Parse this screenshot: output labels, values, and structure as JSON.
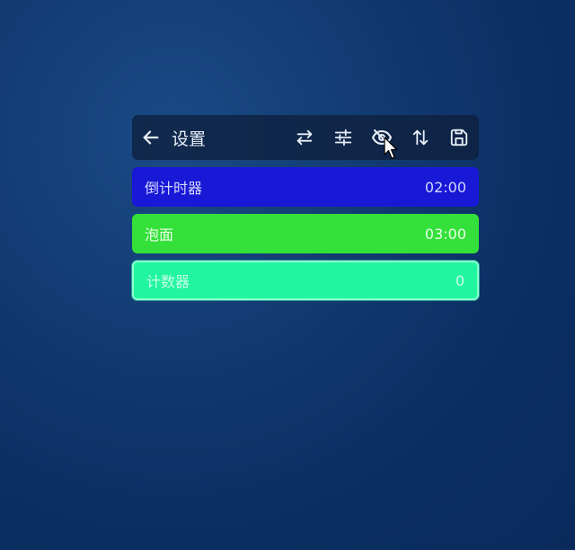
{
  "header": {
    "title": "设置"
  },
  "toolbar": {
    "icons": [
      "swap-icon",
      "sliders-icon",
      "eye-off-icon",
      "sort-icon",
      "save-icon"
    ]
  },
  "timers": [
    {
      "name": "倒计时器",
      "value": "02:00",
      "color": "#1818d6"
    },
    {
      "name": "泡面",
      "value": "03:00",
      "color": "#34e03a"
    },
    {
      "name": "计数器",
      "value": "0",
      "color": "#22f5a0"
    }
  ]
}
